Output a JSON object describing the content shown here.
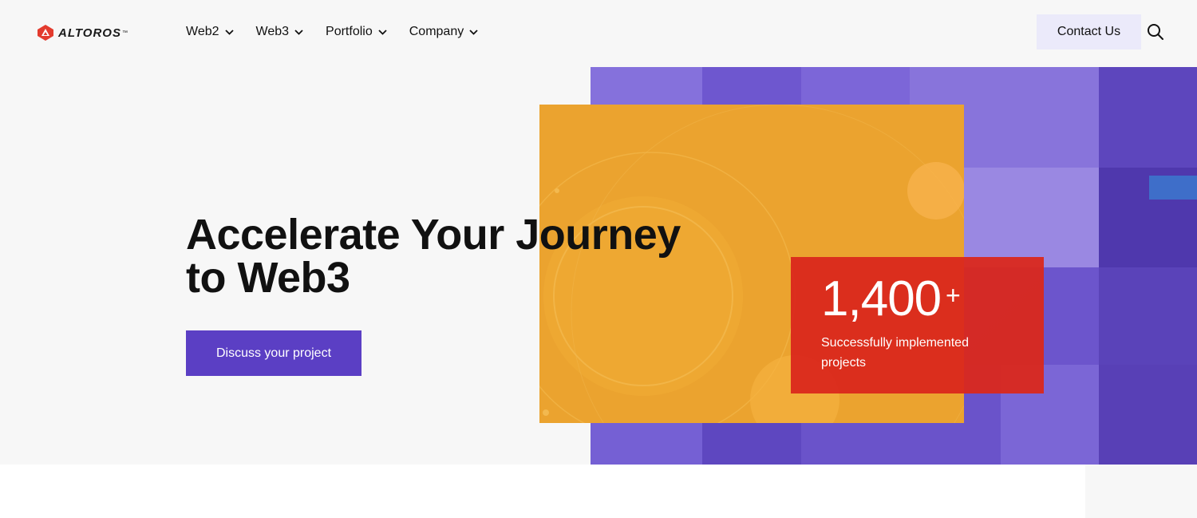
{
  "header": {
    "logo_text": "ALTOROS",
    "logo_tm": "™",
    "nav": [
      {
        "label": "Web2"
      },
      {
        "label": "Web3"
      },
      {
        "label": "Portfolio"
      },
      {
        "label": "Company"
      }
    ],
    "contact_label": "Contact Us"
  },
  "hero": {
    "headline": "Accelerate Your Journey to Web3",
    "cta_label": "Discuss your project",
    "stat": {
      "value": "1,400",
      "suffix": "+",
      "label": "Successfully implemented projects"
    }
  },
  "colors": {
    "brand_red": "#e33b2e",
    "cta_purple": "#5b3fc4",
    "panel_orange": "#eba32f",
    "collage_purple": "#6f56cf",
    "stat_red": "#da281c"
  },
  "icons": {
    "logo": "altoros-logo-icon",
    "nav_chevron": "chevron-down-icon",
    "search": "search-icon"
  }
}
